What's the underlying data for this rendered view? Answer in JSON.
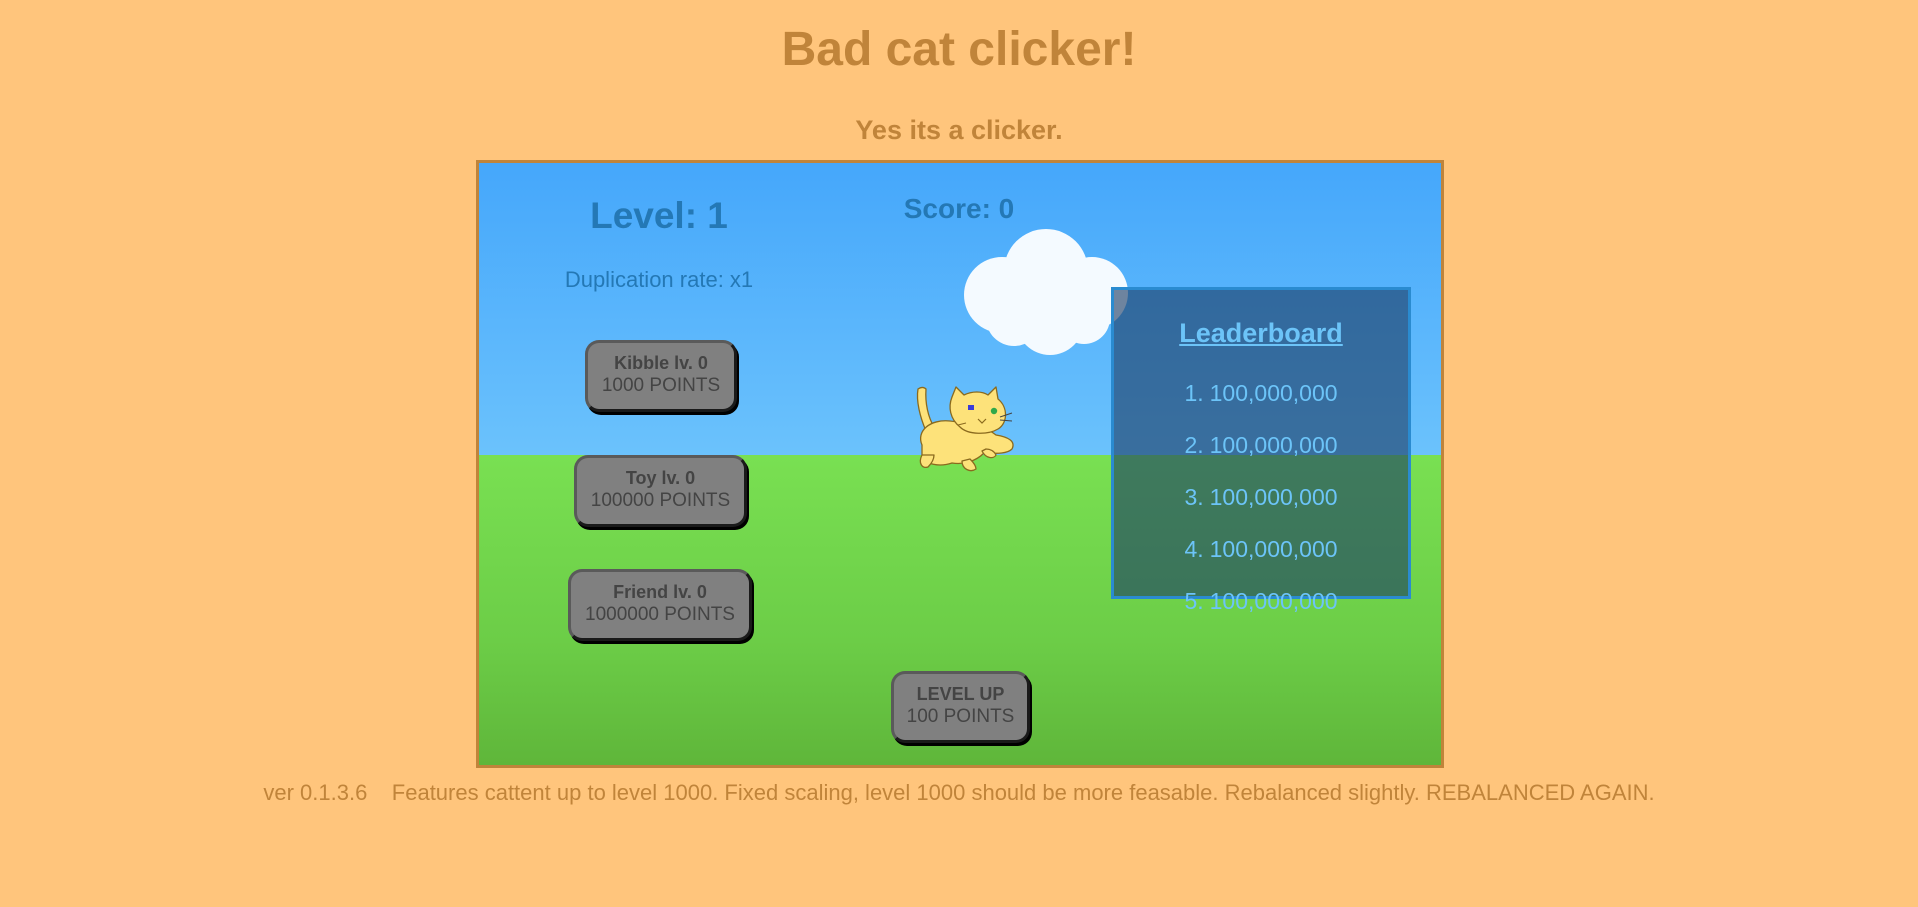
{
  "header": {
    "title": "Bad cat clicker!",
    "subtitle": "Yes its a clicker."
  },
  "game": {
    "level_label": "Level: 1",
    "score_label": "Score: 0",
    "duplication_label": "Duplication rate: x1",
    "upgrades": [
      {
        "name": "Kibble lv. 0",
        "cost": "1000 POINTS"
      },
      {
        "name": "Toy lv. 0",
        "cost": "100000 POINTS"
      },
      {
        "name": "Friend lv. 0",
        "cost": "1000000 POINTS"
      }
    ],
    "level_up": {
      "name": "LEVEL UP",
      "cost": "100 POINTS"
    },
    "leaderboard": {
      "title": "Leaderboard",
      "entries": [
        {
          "rank": "1.",
          "score": "100,000,000"
        },
        {
          "rank": "2.",
          "score": "100,000,000"
        },
        {
          "rank": "3.",
          "score": "100,000,000"
        },
        {
          "rank": "4.",
          "score": "100,000,000"
        },
        {
          "rank": "5.",
          "score": "100,000,000"
        }
      ]
    }
  },
  "footer": {
    "version": "ver 0.1.3.6",
    "notes": "Features cattent up to level 1000. Fixed scaling, level 1000 should be more feasable. Rebalanced slightly. REBALANCED AGAIN."
  },
  "colors": {
    "page_background": "#ffc57c",
    "title_color": "#c0843a",
    "sky": "#46a8fa",
    "grass": "#79e052",
    "button": "#808080",
    "leaderboard_text": "#6cc4f8"
  },
  "icons": {
    "cat": "cat-sprite",
    "cloud": "cloud-decoration"
  }
}
